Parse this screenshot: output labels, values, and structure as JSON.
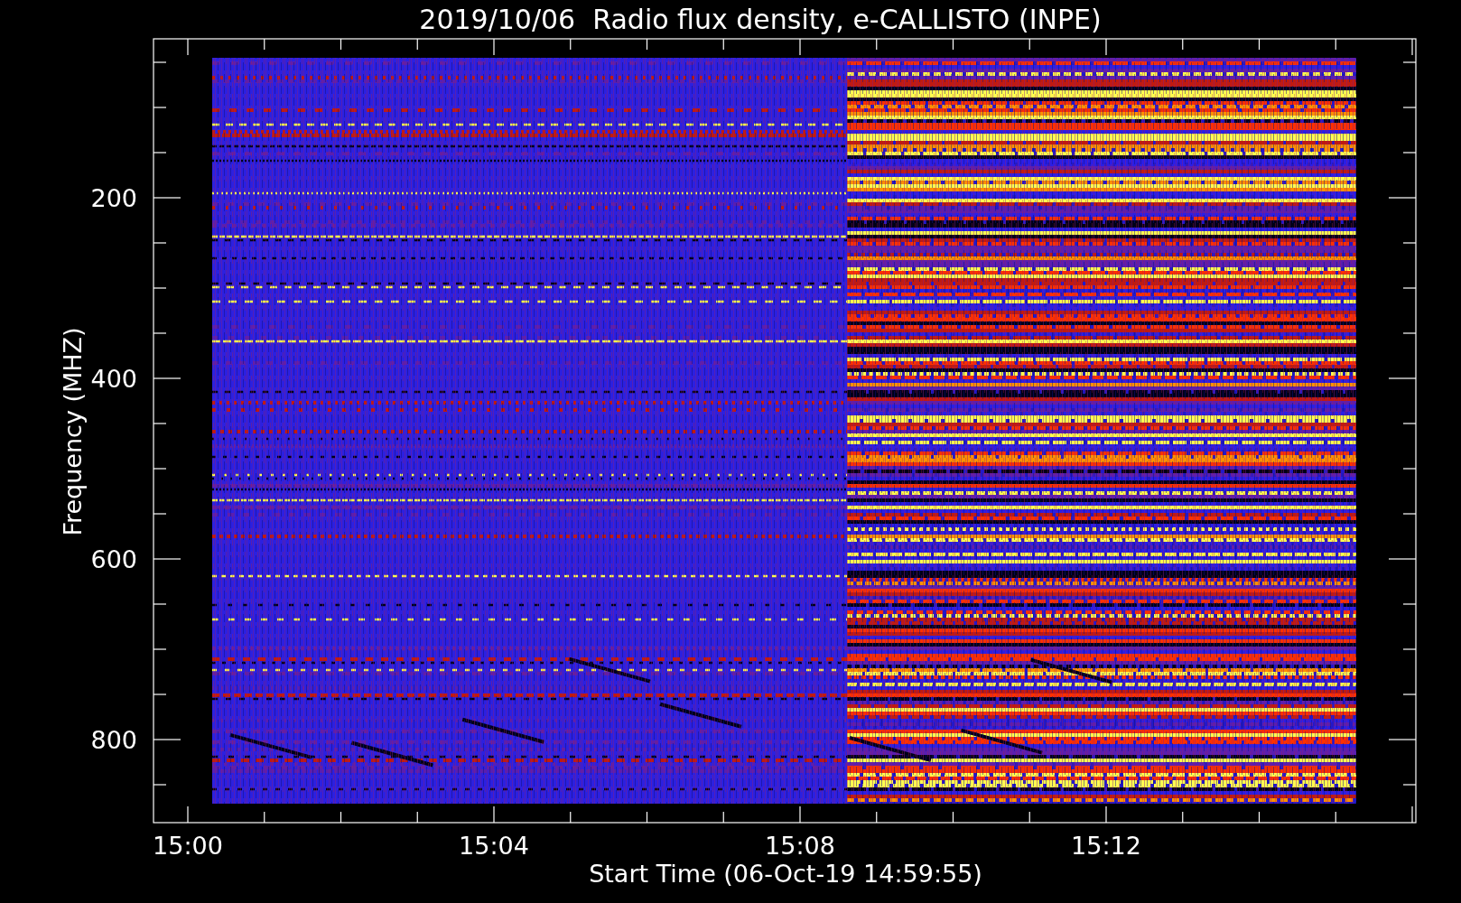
{
  "title": "2019/10/06  Radio flux density, e-CALLISTO (INPE)",
  "y_axis": {
    "label": "Frequency (MHZ)",
    "ticks": [
      "200",
      "400",
      "600",
      "800"
    ]
  },
  "x_axis": {
    "label": "Start Time (06-Oct-19 14:59:55)",
    "ticks": [
      "15:00",
      "15:04",
      "15:08",
      "15:12"
    ]
  }
}
